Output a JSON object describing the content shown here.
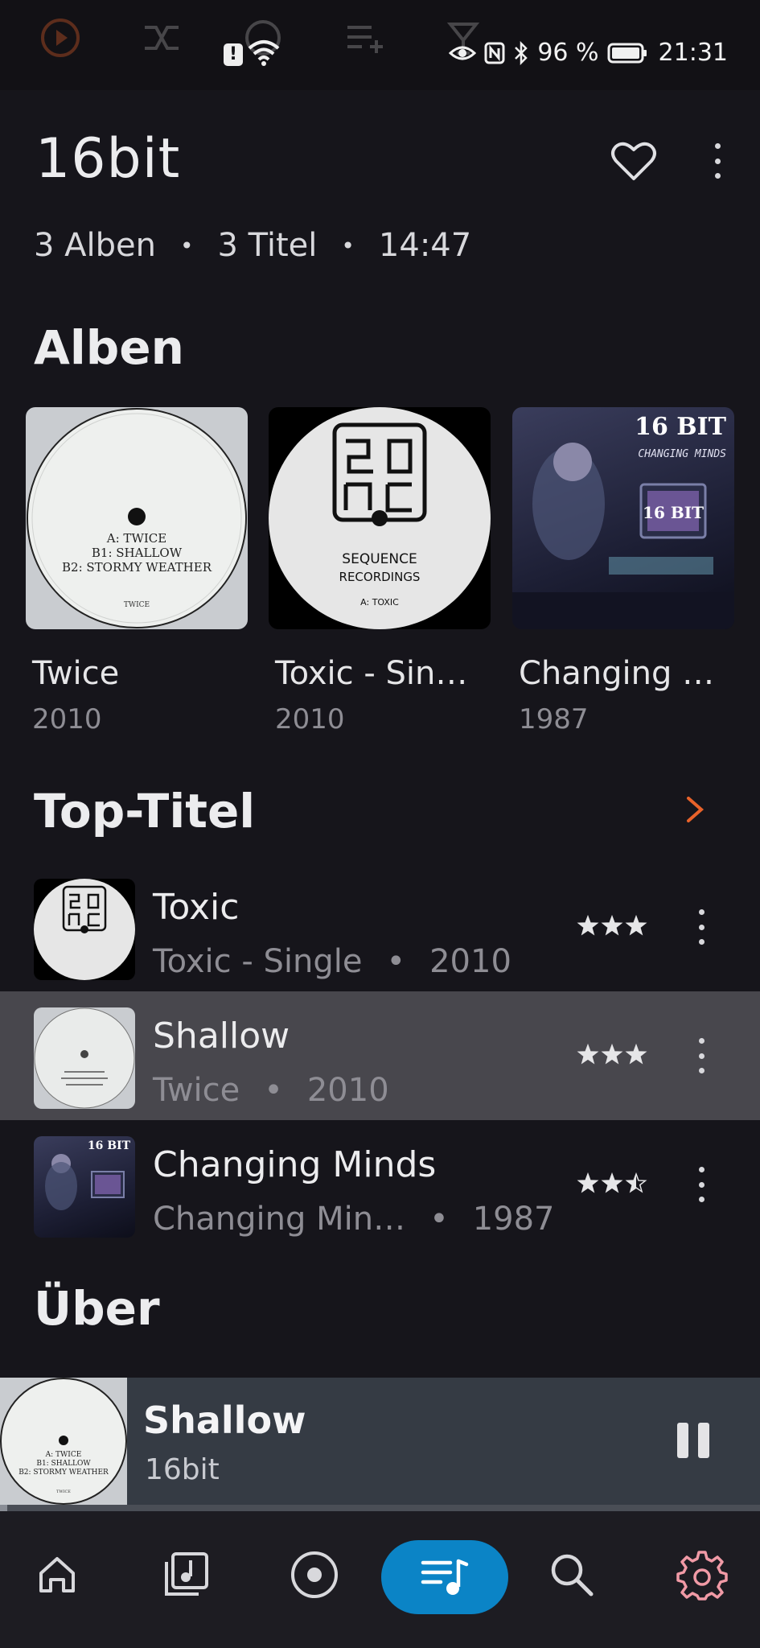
{
  "status_bar": {
    "battery": "96 %",
    "time": "21:31",
    "warning_glyph": "!",
    "left_icons": [
      "play-circle-icon",
      "shuffle-icon",
      "repeat-icon",
      "playlist-add-icon",
      "cocktail-icon"
    ],
    "right_icons": [
      "eye-icon",
      "nfc-icon",
      "bluetooth-icon",
      "battery-icon"
    ]
  },
  "artist": {
    "name": "16bit",
    "stats": {
      "albums": "3 Alben",
      "tracks": "3 Titel",
      "duration": "14:47",
      "separator": "•"
    }
  },
  "sections": {
    "albums": "Alben",
    "top_tracks": "Top-Titel",
    "about": "Über"
  },
  "albums": [
    {
      "title": "Twice",
      "year": "2010",
      "cover_text": [
        "A: TWICE",
        "B1: SHALLOW",
        "B2: STORMY WEATHER",
        "TWICE"
      ]
    },
    {
      "title": "Toxic - Sin…",
      "year": "2010",
      "cover_text": [
        "SEQUENCE",
        "RECORDINGS",
        "A: TOXIC"
      ]
    },
    {
      "title": "Changing …",
      "year": "1987",
      "cover_text": [
        "16 BIT",
        "CHANGING MINDS",
        "16 BIT"
      ]
    }
  ],
  "top_tracks": [
    {
      "title": "Toxic",
      "album": "Toxic - Single",
      "year": "2010",
      "rating": 3,
      "active": false
    },
    {
      "title": "Shallow",
      "album": "Twice",
      "year": "2010",
      "rating": 3,
      "active": true
    },
    {
      "title": "Changing Minds",
      "album": "Changing Min…",
      "year": "1987",
      "rating": 2.5,
      "active": false
    }
  ],
  "now_playing": {
    "title": "Shallow",
    "artist": "16bit",
    "progress": 0.01
  },
  "bottom_nav": {
    "items": [
      "home-icon",
      "library-icon",
      "album-icon",
      "queue-icon",
      "search-icon",
      "settings-icon"
    ],
    "active": "queue-icon"
  },
  "colors": {
    "background": "#16151b",
    "accent_orange": "#e8622a",
    "nav_active": "#0b84c6",
    "settings_icon": "#f19aa6",
    "now_playing_bg": "#353b44"
  }
}
